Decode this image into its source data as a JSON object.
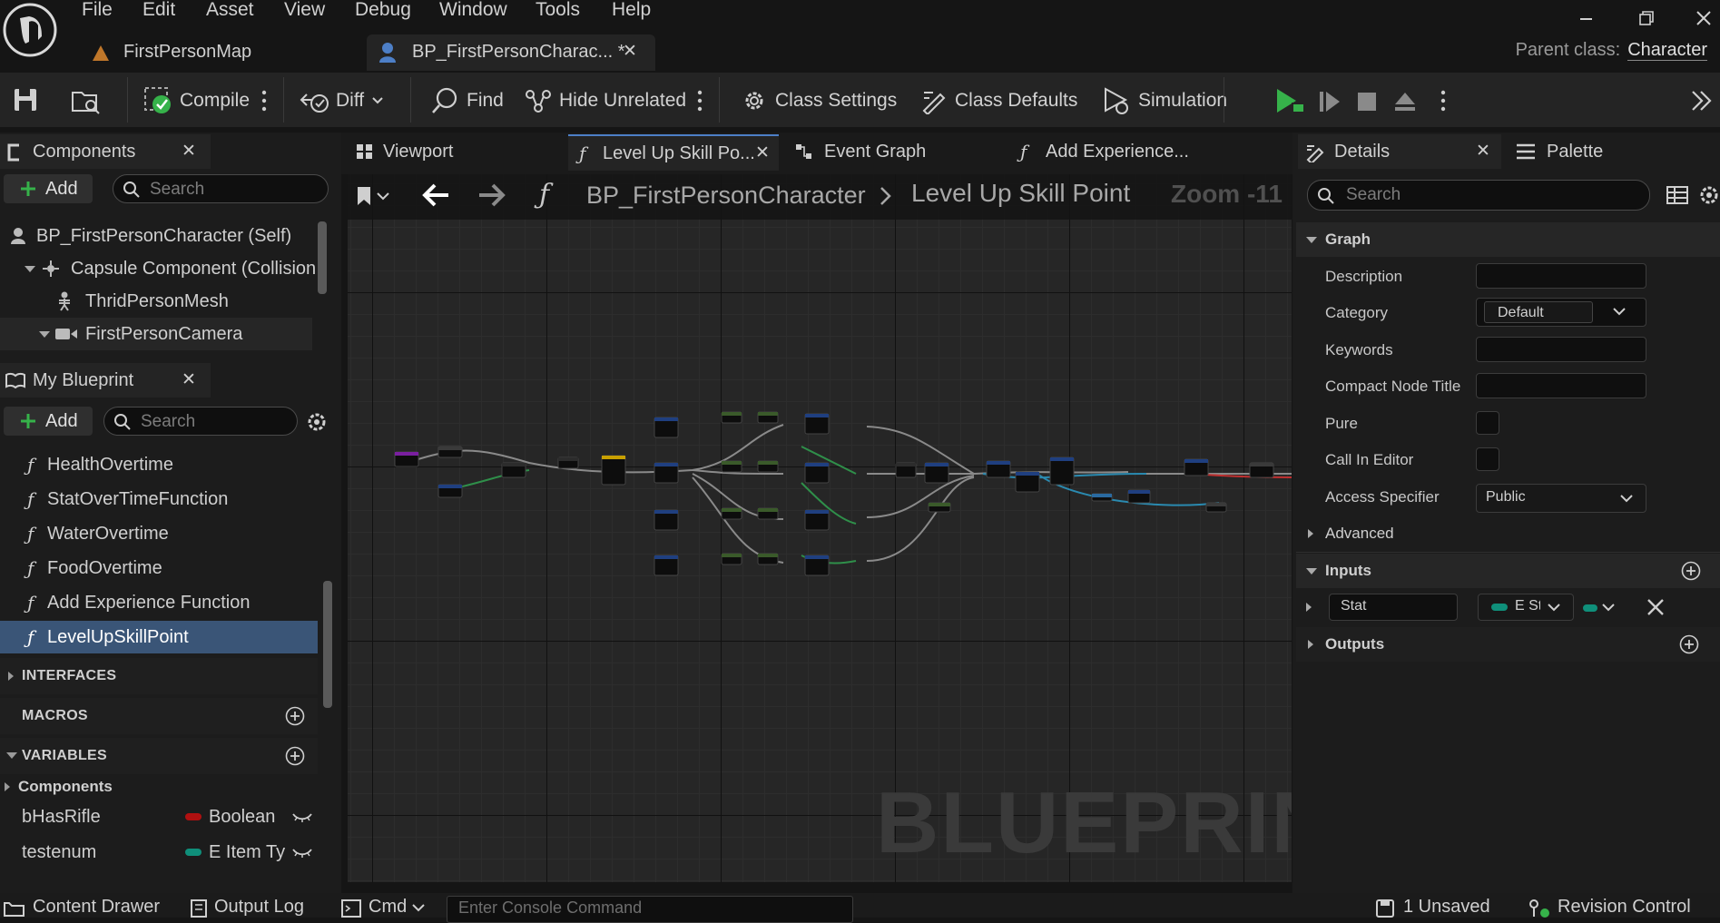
{
  "menu": [
    "File",
    "Edit",
    "Asset",
    "View",
    "Debug",
    "Window",
    "Tools",
    "Help"
  ],
  "doc_tabs": [
    {
      "label": "FirstPersonMap"
    },
    {
      "label": "BP_FirstPersonCharac... *"
    }
  ],
  "parent_class": {
    "label": "Parent class:",
    "value": "Character"
  },
  "toolbar": {
    "compile": "Compile",
    "diff": "Diff",
    "find": "Find",
    "hide_unrelated": "Hide Unrelated",
    "class_settings": "Class Settings",
    "class_defaults": "Class Defaults",
    "simulation": "Simulation"
  },
  "components": {
    "tab": "Components",
    "add": "Add",
    "search_placeholder": "Search",
    "tree": [
      "BP_FirstPersonCharacter (Self)",
      "Capsule Component (Collision",
      "ThridPersonMesh",
      "FirstPersonCamera"
    ]
  },
  "my_blueprint": {
    "tab": "My Blueprint",
    "add": "Add",
    "search_placeholder": "Search",
    "functions": [
      "HealthOvertime",
      "StatOverTimeFunction",
      "WaterOvertime",
      "FoodOvertime",
      "Add Experience Function",
      "LevelUpSkillPoint"
    ],
    "sections": {
      "interfaces": "INTERFACES",
      "macros": "MACROS",
      "variables": "VARIABLES"
    },
    "var_category": "Components",
    "variables": [
      {
        "name": "bHasRifle",
        "type": "Boolean",
        "color": "#b01010"
      },
      {
        "name": "testenum",
        "type": "E Item Ty",
        "color": "#0f8f7a"
      }
    ]
  },
  "graph_tabs": [
    "Viewport",
    "Level Up Skill Po...",
    "Event Graph",
    "Add Experience..."
  ],
  "graph": {
    "breadcrumb_root": "BP_FirstPersonCharacter",
    "breadcrumb_leaf": "Level Up Skill Point",
    "zoom": "Zoom -11",
    "watermark": "BLUEPRINT"
  },
  "details": {
    "tab": "Details",
    "palette_tab": "Palette",
    "search_placeholder": "Search",
    "graph_section": "Graph",
    "fields": {
      "description": "Description",
      "category": "Category",
      "category_value": "Default",
      "keywords": "Keywords",
      "compact_node_title": "Compact Node Title",
      "pure": "Pure",
      "call_in_editor": "Call In Editor",
      "access_specifier": "Access Specifier",
      "access_value": "Public"
    },
    "advanced": "Advanced",
    "inputs": "Inputs",
    "input_param": {
      "name": "Stat",
      "type": "E St"
    },
    "outputs": "Outputs"
  },
  "statusbar": {
    "content_drawer": "Content Drawer",
    "output_log": "Output Log",
    "cmd": "Cmd",
    "console_placeholder": "Enter Console Command",
    "unsaved": "1 Unsaved",
    "revision_control": "Revision Control"
  },
  "colors": {
    "accent_blue": "#4d7fc7",
    "selected_row": "#3a5577",
    "play_green": "#36b24a"
  }
}
